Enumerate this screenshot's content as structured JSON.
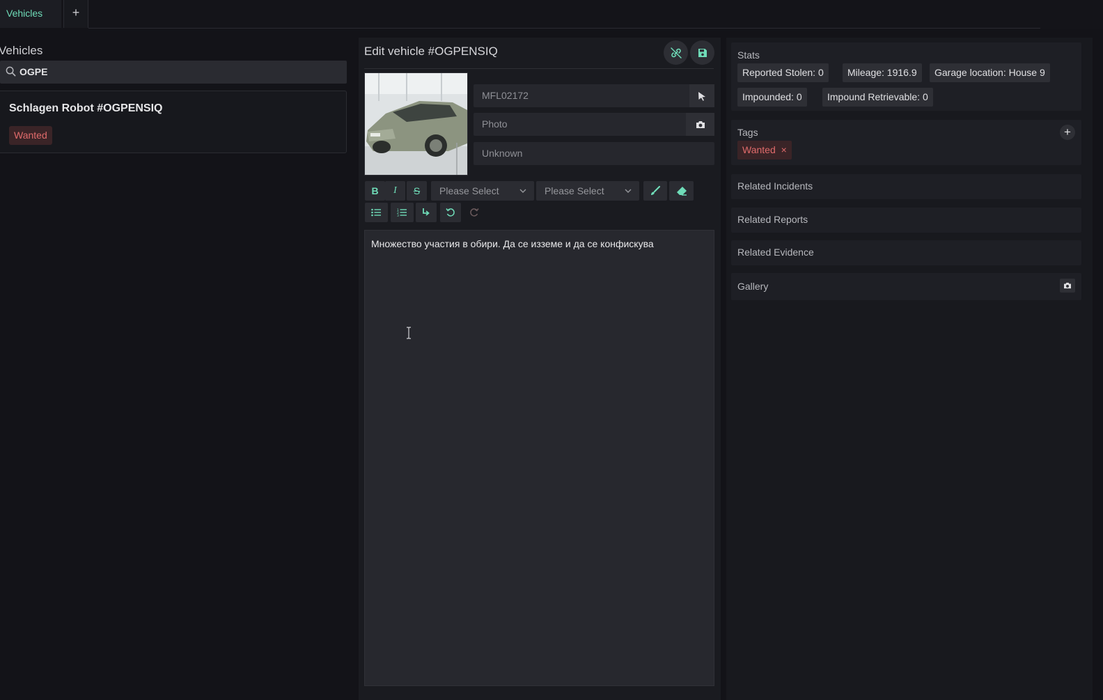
{
  "tabs": {
    "active_label": "Vehicles",
    "add_label": "+"
  },
  "left": {
    "title": "Vehicles",
    "search": {
      "value": "OGPE",
      "icon": "search-icon"
    },
    "results": [
      {
        "title": "Schlagen Robot #OGPENSIQ",
        "tag": "Wanted"
      }
    ]
  },
  "editor": {
    "title": "Edit vehicle #OGPENSIQ",
    "header_icons": [
      "unlink-icon",
      "save-icon"
    ],
    "plate": {
      "value": "MFL02172",
      "button_icon": "cursor-pointer-icon"
    },
    "photo": {
      "placeholder": "Photo",
      "button_icon": "camera-icon"
    },
    "status": {
      "value": "Unknown"
    },
    "toolbar": {
      "bold": "B",
      "italic": "I",
      "strike": "S",
      "select1": "Please Select",
      "select2": "Please Select",
      "icons": [
        "brush-icon",
        "eraser-icon",
        "bullet-list-icon",
        "numbered-list-icon",
        "indent-icon",
        "undo-icon",
        "redo-icon"
      ]
    },
    "content": "Множество участия в обири. Да се изземе и да се конфискува"
  },
  "right": {
    "stats": {
      "label": "Stats",
      "items": [
        "Reported Stolen: 0",
        "Mileage: 1916.9",
        "Garage location: House 9",
        "Impounded: 0",
        "Impound Retrievable: 0"
      ]
    },
    "tags": {
      "label": "Tags",
      "items": [
        {
          "label": "Wanted",
          "remove": "×"
        }
      ],
      "add_label": "+"
    },
    "related_incidents": "Related Incidents",
    "related_reports": "Related Reports",
    "related_evidence": "Related Evidence",
    "gallery": {
      "label": "Gallery",
      "icon": "camera-icon"
    }
  },
  "colors": {
    "accent": "#6fdcb8",
    "danger": "#e06b6b",
    "danger_bg": "#3a2427",
    "background": "#131318",
    "panel": "#1a1b20"
  }
}
